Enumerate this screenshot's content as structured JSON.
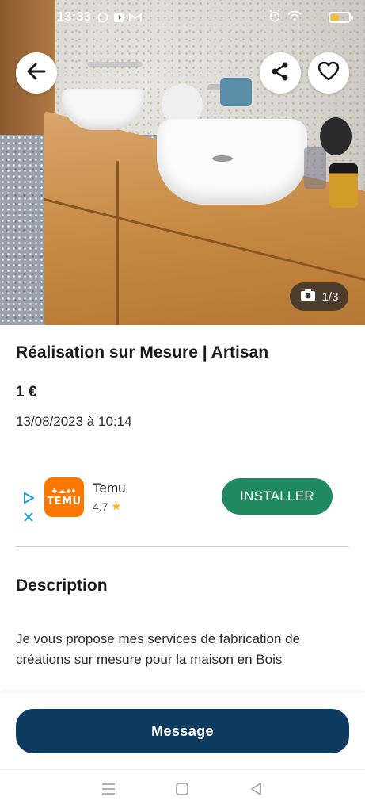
{
  "status_bar": {
    "time": "13:33",
    "left_icons": [
      "whatsapp-icon",
      "app-icon",
      "gmail-icon"
    ],
    "right_icons": [
      "alarm-icon",
      "wifi-icon",
      "signal-icon",
      "battery-icon"
    ],
    "battery_level": 0.45,
    "battery_color": "#f2c230"
  },
  "listing": {
    "photo_counter": "1/3",
    "photo_index": 1,
    "photo_total": 3,
    "title": "Réalisation sur Mesure | Artisan",
    "price": "1 €",
    "date": "13/08/2023 à 10:14"
  },
  "ad": {
    "app_name": "Temu",
    "rating": "4.7",
    "logo_text": "TEMU",
    "logo_color": "#fb7701",
    "install_label": "INSTALLER",
    "install_color": "#1f8a5f"
  },
  "description": {
    "heading": "Description",
    "body": "Je vous propose mes services de fabrication de créations sur mesure pour la maison en Bois"
  },
  "actions": {
    "message_label": "Message",
    "message_color": "#0d3a5f"
  },
  "nav": {
    "items": [
      "menu-icon",
      "home-icon",
      "back-triangle-icon"
    ]
  }
}
